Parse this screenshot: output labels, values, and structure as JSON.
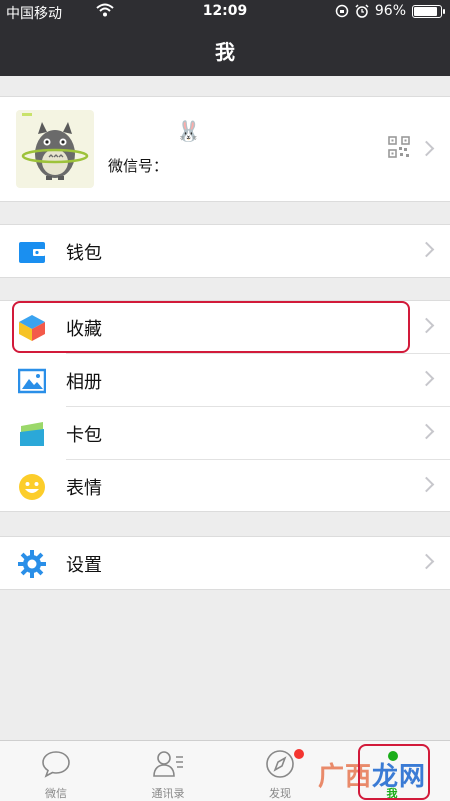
{
  "status": {
    "carrier": "中国移动",
    "time": "12:09",
    "battery": "96%",
    "battery_level": 0.96
  },
  "nav": {
    "title": "我"
  },
  "profile": {
    "emoji": "🐰",
    "wechat_id_label": "微信号："
  },
  "menu": {
    "wallet": "钱包",
    "favorites": "收藏",
    "album": "相册",
    "cards": "卡包",
    "stickers": "表情",
    "settings": "设置"
  },
  "tabs": [
    {
      "label": "微信",
      "icon": "chat-icon"
    },
    {
      "label": "通讯录",
      "icon": "contacts-icon"
    },
    {
      "label": "发现",
      "icon": "compass-icon"
    },
    {
      "label": "我",
      "icon": "me-icon"
    }
  ],
  "watermark": {
    "part1": "广西",
    "part2": "龙网"
  },
  "colors": {
    "accent": "#1aad19",
    "highlight": "#d21a3a",
    "topbar": "#2e2e32"
  }
}
